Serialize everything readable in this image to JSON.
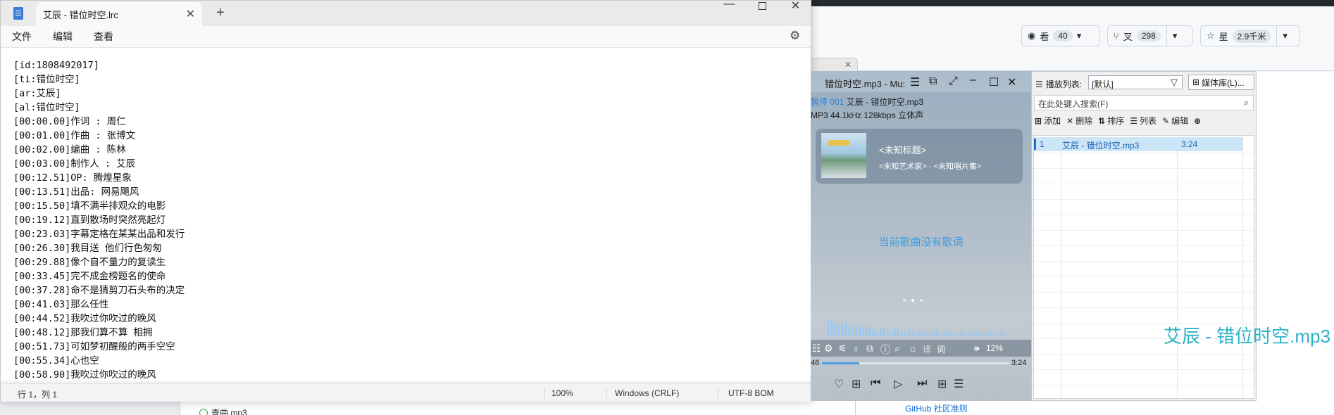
{
  "github": {
    "watch": {
      "label": "看",
      "count": "40"
    },
    "fork": {
      "label": "叉",
      "count": "298"
    },
    "star": {
      "label": "星",
      "count": "2.9千米"
    },
    "guide_link": "GitHub 社区准则",
    "bottom_file": "查曲.mp3"
  },
  "notepad": {
    "tab_title": "艾辰 - 错位时空.lrc",
    "menu": [
      "文件",
      "编辑",
      "查看"
    ],
    "lines": [
      "[id:1808492017]",
      "[ti:错位时空]",
      "[ar:艾辰]",
      "[al:错位时空]",
      "[00:00.00]作词 : 周仁",
      "[00:01.00]作曲 : 张博文",
      "[00:02.00]编曲 : 陈林",
      "[00:03.00]制作人 : 艾辰",
      "[00:12.51]OP: 腾煌星象",
      "[00:13.51]出品: 网易飓风",
      "[00:15.50]填不满半排观众的电影",
      "[00:19.12]直到散场时突然亮起灯",
      "[00:23.03]字幕定格在某某出品和发行",
      "[00:26.30]我目送 他们行色匆匆",
      "[00:29.88]像个自不量力的复读生",
      "[00:33.45]完不成金榜题名的使命",
      "[00:37.28]命不是猜剪刀石头布的决定",
      "[00:41.03]那么任性",
      "[00:44.52]我吹过你吹过的晚风",
      "[00:48.12]那我们算不算 相拥",
      "[00:51.73]可如梦初醒般的两手空空",
      "[00:55.34]心也空",
      "[00:58.90]我吹过你吹过的晚风"
    ],
    "status": {
      "position": "行 1，列 1",
      "zoom": "100%",
      "line_ending": "Windows (CRLF)",
      "encoding": "UTF-8 BOM"
    }
  },
  "player": {
    "title": "错位时空.mp3 - Mu:",
    "status_line_accent": "暂停 001",
    "status_line_rest": " 艾辰 - 错位时空.mp3",
    "format_line": "MP3 44.1kHz 128kbps 立体声",
    "song_title": "<未知标题>",
    "song_meta": "<未知艺术家> - <未知唱片集>",
    "no_lyrics": "当前歌曲没有歌词",
    "volume": "12%",
    "time_elapsed": "46",
    "time_total": "3:24",
    "progress_fraction": 0.2,
    "accent_color": "#4aa0e8"
  },
  "playlist": {
    "label": "播放列表:",
    "selected": "[默认]",
    "media_library": "媒体库(L)...",
    "search_placeholder": "在此处键入搜索(F)",
    "actions": [
      "添加",
      "删除",
      "排序",
      "列表",
      "编辑"
    ],
    "rows": [
      {
        "index": "1",
        "title": "艾辰 - 错位时空.mp3",
        "duration": "3:24"
      }
    ]
  },
  "overlay_filename": "艾辰 - 错位时空.mp3"
}
